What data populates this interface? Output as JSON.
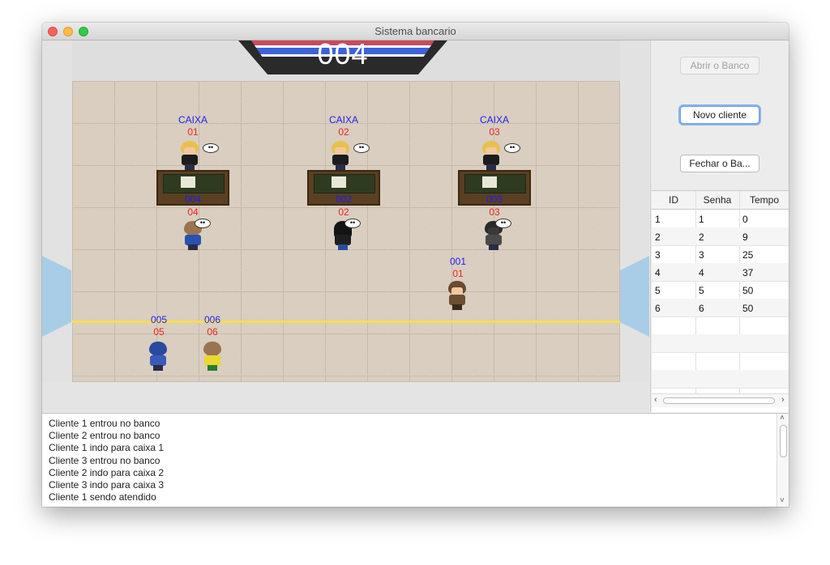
{
  "window": {
    "title": "Sistema bancario"
  },
  "scene": {
    "counter_number": "004",
    "tellers": [
      {
        "label": "CAIXA",
        "number": "01"
      },
      {
        "label": "CAIXA",
        "number": "02"
      },
      {
        "label": "CAIXA",
        "number": "03"
      }
    ],
    "served_clients": [
      {
        "id": "004",
        "number": "04"
      },
      {
        "id": "002",
        "number": "02"
      },
      {
        "id": "003",
        "number": "03"
      }
    ],
    "walking_client": {
      "id": "001",
      "number": "01"
    },
    "queue_clients": [
      {
        "id": "005",
        "number": "05"
      },
      {
        "id": "006",
        "number": "06"
      }
    ],
    "colors": {
      "label_blue": "#1e1ef0",
      "label_red": "#f02424",
      "queue_line": "#f5e04d"
    }
  },
  "controls": {
    "open_bank": "Abrir o Banco",
    "new_client": "Novo cliente",
    "close_bank": "Fechar o Ba..."
  },
  "table": {
    "headers": [
      "ID",
      "Senha",
      "Tempo"
    ],
    "rows": [
      [
        "1",
        "1",
        "0"
      ],
      [
        "2",
        "2",
        "9"
      ],
      [
        "3",
        "3",
        "25"
      ],
      [
        "4",
        "4",
        "37"
      ],
      [
        "5",
        "5",
        "50"
      ],
      [
        "6",
        "6",
        "50"
      ]
    ]
  },
  "log": [
    "Cliente 1 entrou no banco",
    "Cliente 2 entrou no banco",
    "Cliente 1 indo para caixa 1",
    "Cliente 3 entrou no banco",
    "Cliente 2 indo para caixa 2",
    "Cliente 3 indo para caixa 3",
    "Cliente 1 sendo atendido"
  ]
}
